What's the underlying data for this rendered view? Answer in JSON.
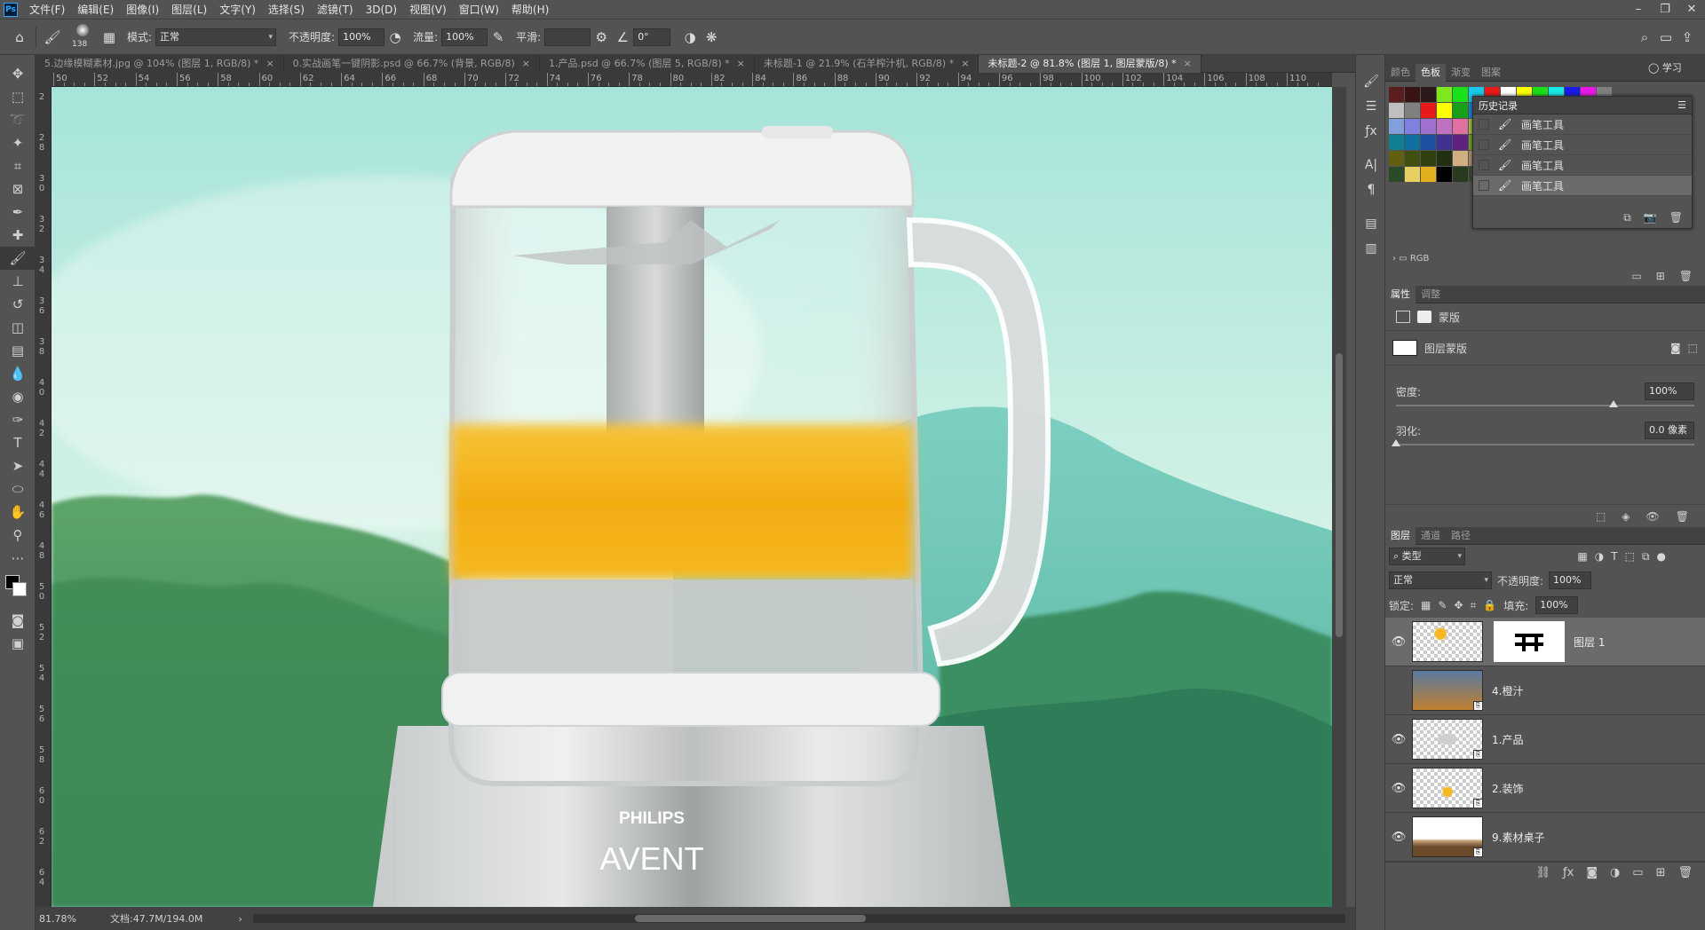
{
  "menubar": {
    "items": [
      "文件(F)",
      "编辑(E)",
      "图像(I)",
      "图层(L)",
      "文字(Y)",
      "选择(S)",
      "滤镜(T)",
      "3D(D)",
      "视图(V)",
      "窗口(W)",
      "帮助(H)"
    ],
    "logo": "Ps",
    "win_min": "–",
    "win_max": "❐",
    "win_close": "✕"
  },
  "options": {
    "brush_size": "138",
    "mode_label": "模式:",
    "mode_value": "正常",
    "opacity_label": "不透明度:",
    "opacity_value": "100%",
    "flow_label": "流量:",
    "flow_value": "100%",
    "smooth_label": "平滑:",
    "smooth_value": "",
    "angle_value": "0°"
  },
  "tabs": [
    {
      "label": "5.边缘模糊素材.jpg @ 104% (图层 1, RGB/8) *",
      "active": false
    },
    {
      "label": "0.实战画笔一键阴影.psd @ 66.7% (背景, RGB/8)",
      "active": false
    },
    {
      "label": "1.产品.psd @ 66.7% (图层 5, RGB/8) *",
      "active": false
    },
    {
      "label": "未标题-1 @ 21.9% (石羊榨汁机, RGB/8) *",
      "active": false
    },
    {
      "label": "未标题-2 @ 81.8% (图层 1, 图层蒙版/8) *",
      "active": true
    }
  ],
  "ruler_top": [
    "50",
    "52",
    "54",
    "56",
    "58",
    "60",
    "62",
    "64",
    "66",
    "68",
    "70",
    "72",
    "74",
    "76",
    "78",
    "80",
    "82",
    "84",
    "86",
    "88",
    "90",
    "92",
    "94",
    "96",
    "98",
    "100",
    "102",
    "104",
    "106",
    "108",
    "110"
  ],
  "ruler_left": [
    "2",
    "2 8",
    "3 0",
    "3 2",
    "3 4",
    "3 6",
    "3 8",
    "4 0",
    "4 2",
    "4 4",
    "4 6",
    "4 8",
    "5 0",
    "5 2",
    "5 4",
    "5 6",
    "5 8",
    "6 0",
    "6 2",
    "6 4"
  ],
  "canvas": {
    "brand_top": "PHILIPS",
    "brand_bottom": "AVENT"
  },
  "status": {
    "zoom": "81.78%",
    "doc": "文档:47.7M/194.0M"
  },
  "color_panel": {
    "tabs": [
      "颜色",
      "色板",
      "渐变",
      "图案"
    ],
    "active_tab": "色板",
    "swatches": [
      "#5a1e1e",
      "#3a1414",
      "#2a1a1a",
      "#7ee81a",
      "#19e019",
      "#19c8e8",
      "#e81919",
      "#ffffff",
      "#ffff00",
      "#19e019",
      "#19e8e8",
      "#1919e8",
      "#e819e8",
      "#808080",
      "#bfbfbf",
      "#808080",
      "#e81919",
      "#ffff00",
      "#19a019",
      "#197fd8",
      "#e8a0a0",
      "#404040",
      "#202020",
      "#000000",
      "#2aa84a",
      "#1890d0",
      "#e090a0",
      "#e0a040",
      "#7fa0d8",
      "#8080e0",
      "#a070d0",
      "#c070c0",
      "#e070a0",
      "#a0c040",
      "#19b4e8",
      "#1880d0",
      "#6060c0",
      "#8040b0",
      "#a02090",
      "#c02060",
      "#30a070",
      "#209880",
      "#108090",
      "#1070a0",
      "#2050a0",
      "#403090",
      "#602080",
      "#70a020",
      "#508020",
      "#306020",
      "#206040",
      "#106060",
      "#105070",
      "#204070",
      "#a09020",
      "#808010",
      "#606010",
      "#405010",
      "#304010",
      "#203010",
      "#d0b080",
      "#b09070",
      "#907050",
      "#705030",
      "#e0c060",
      "#c0a050",
      "#a08040",
      "#806030",
      "#19e8c8",
      "#1a3a2a",
      "#2a4a2a",
      "#e8d060",
      "#e0b020",
      "#000000",
      "#2a3a20",
      "#3a4a30",
      "#202020"
    ],
    "folder_label": "RGB"
  },
  "history": {
    "title": "历史记录",
    "items": [
      "画笔工具",
      "画笔工具",
      "画笔工具",
      "画笔工具"
    ],
    "selected_index": 3
  },
  "properties": {
    "tabs": [
      "属性",
      "调整"
    ],
    "mask_label": "蒙版",
    "layer_mask_label": "图层蒙版",
    "density_label": "密度:",
    "density_value": "100%",
    "feather_label": "羽化:",
    "feather_value": "0.0 像素"
  },
  "layers": {
    "tabs": [
      "图层",
      "通道",
      "路径"
    ],
    "filter_label": "类型",
    "blend_mode": "正常",
    "opacity_label": "不透明度:",
    "opacity_value": "100%",
    "lock_label": "锁定:",
    "fill_label": "填充:",
    "fill_value": "100%",
    "rows": [
      {
        "name": "图层 1",
        "visible": true,
        "selected": true
      },
      {
        "name": "4.橙汁",
        "visible": false,
        "selected": false
      },
      {
        "name": "1.产品",
        "visible": true,
        "selected": false
      },
      {
        "name": "2.装饰",
        "visible": true,
        "selected": false
      },
      {
        "name": "9.素材桌子",
        "visible": true,
        "selected": false
      }
    ]
  },
  "learn_label": "学习"
}
